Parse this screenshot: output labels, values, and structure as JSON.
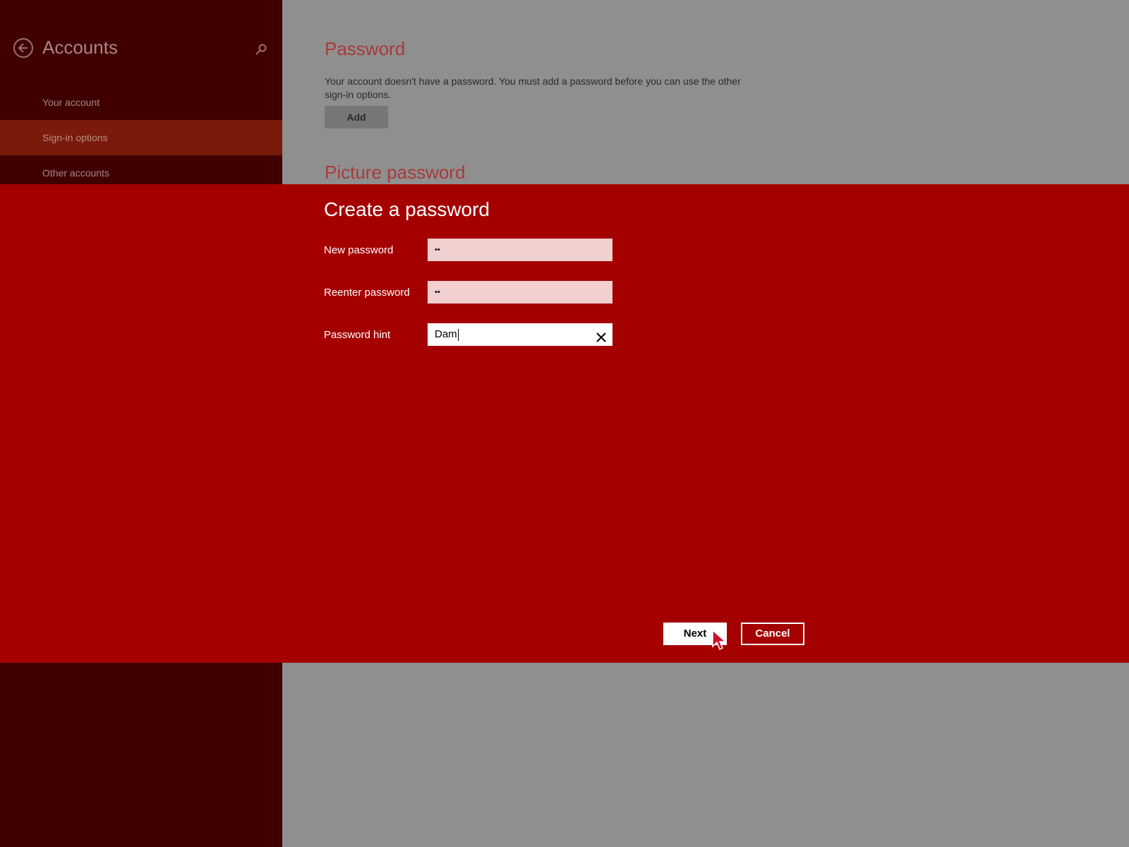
{
  "sidebar": {
    "title": "Accounts",
    "back_icon": "back-arrow-icon",
    "search_icon": "search-icon",
    "items": [
      {
        "label": "Your account",
        "selected": false
      },
      {
        "label": "Sign-in options",
        "selected": true
      },
      {
        "label": "Other accounts",
        "selected": false
      }
    ]
  },
  "content": {
    "password_heading": "Password",
    "password_text": "Your account doesn't have a password. You must add a password before you can use the other sign-in options.",
    "add_button": "Add",
    "picture_password_heading": "Picture password"
  },
  "dialog": {
    "title": "Create a password",
    "fields": [
      {
        "label": "New password",
        "value": "••"
      },
      {
        "label": "Reenter password",
        "value": "••"
      },
      {
        "label": "Password hint",
        "value": "Dam"
      }
    ],
    "clear_icon": "close-icon",
    "next_button": "Next",
    "cancel_button": "Cancel"
  },
  "colors": {
    "sidebar_bg": "#400000",
    "selected_item_bg": "#7a1a0a",
    "dialog_bg": "#a50000",
    "content_bg": "#8f8f8f",
    "heading_color": "#a83a3a"
  }
}
